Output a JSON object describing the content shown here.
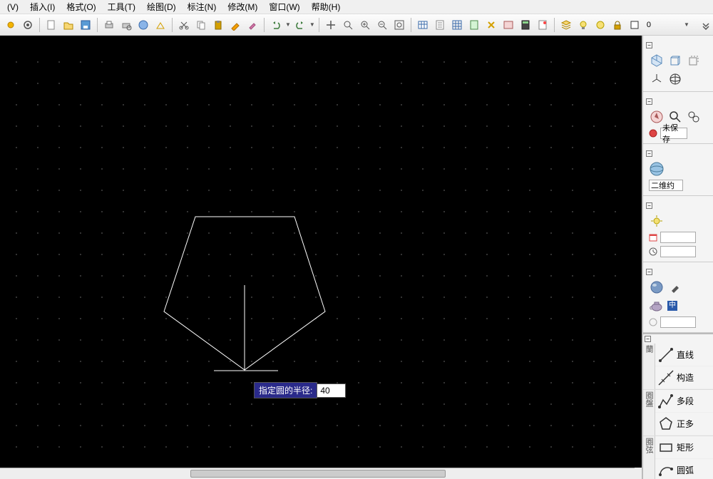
{
  "menu": {
    "items": [
      "(V)",
      "插入(I)",
      "格式(O)",
      "工具(T)",
      "绘图(D)",
      "标注(N)",
      "修改(M)",
      "窗口(W)",
      "帮助(H)"
    ]
  },
  "toolbar": {
    "layer_zero": "0"
  },
  "canvas": {
    "prompt_label": "指定圆的半径:",
    "prompt_value": "40"
  },
  "right": {
    "unsaved": "未保存",
    "two_d": "二维约",
    "section_draw_a": "绘图",
    "section_draw_b": "修改",
    "section_draw_c": "图层",
    "cube_symbol": "中"
  },
  "draw_tools": [
    {
      "name": "line",
      "label": "直线"
    },
    {
      "name": "construction-line",
      "label": "构造"
    },
    {
      "name": "polyline",
      "label": "多段"
    },
    {
      "name": "polygon",
      "label": "正多"
    },
    {
      "name": "rectangle",
      "label": "矩形"
    },
    {
      "name": "arc",
      "label": "圆弧"
    }
  ]
}
